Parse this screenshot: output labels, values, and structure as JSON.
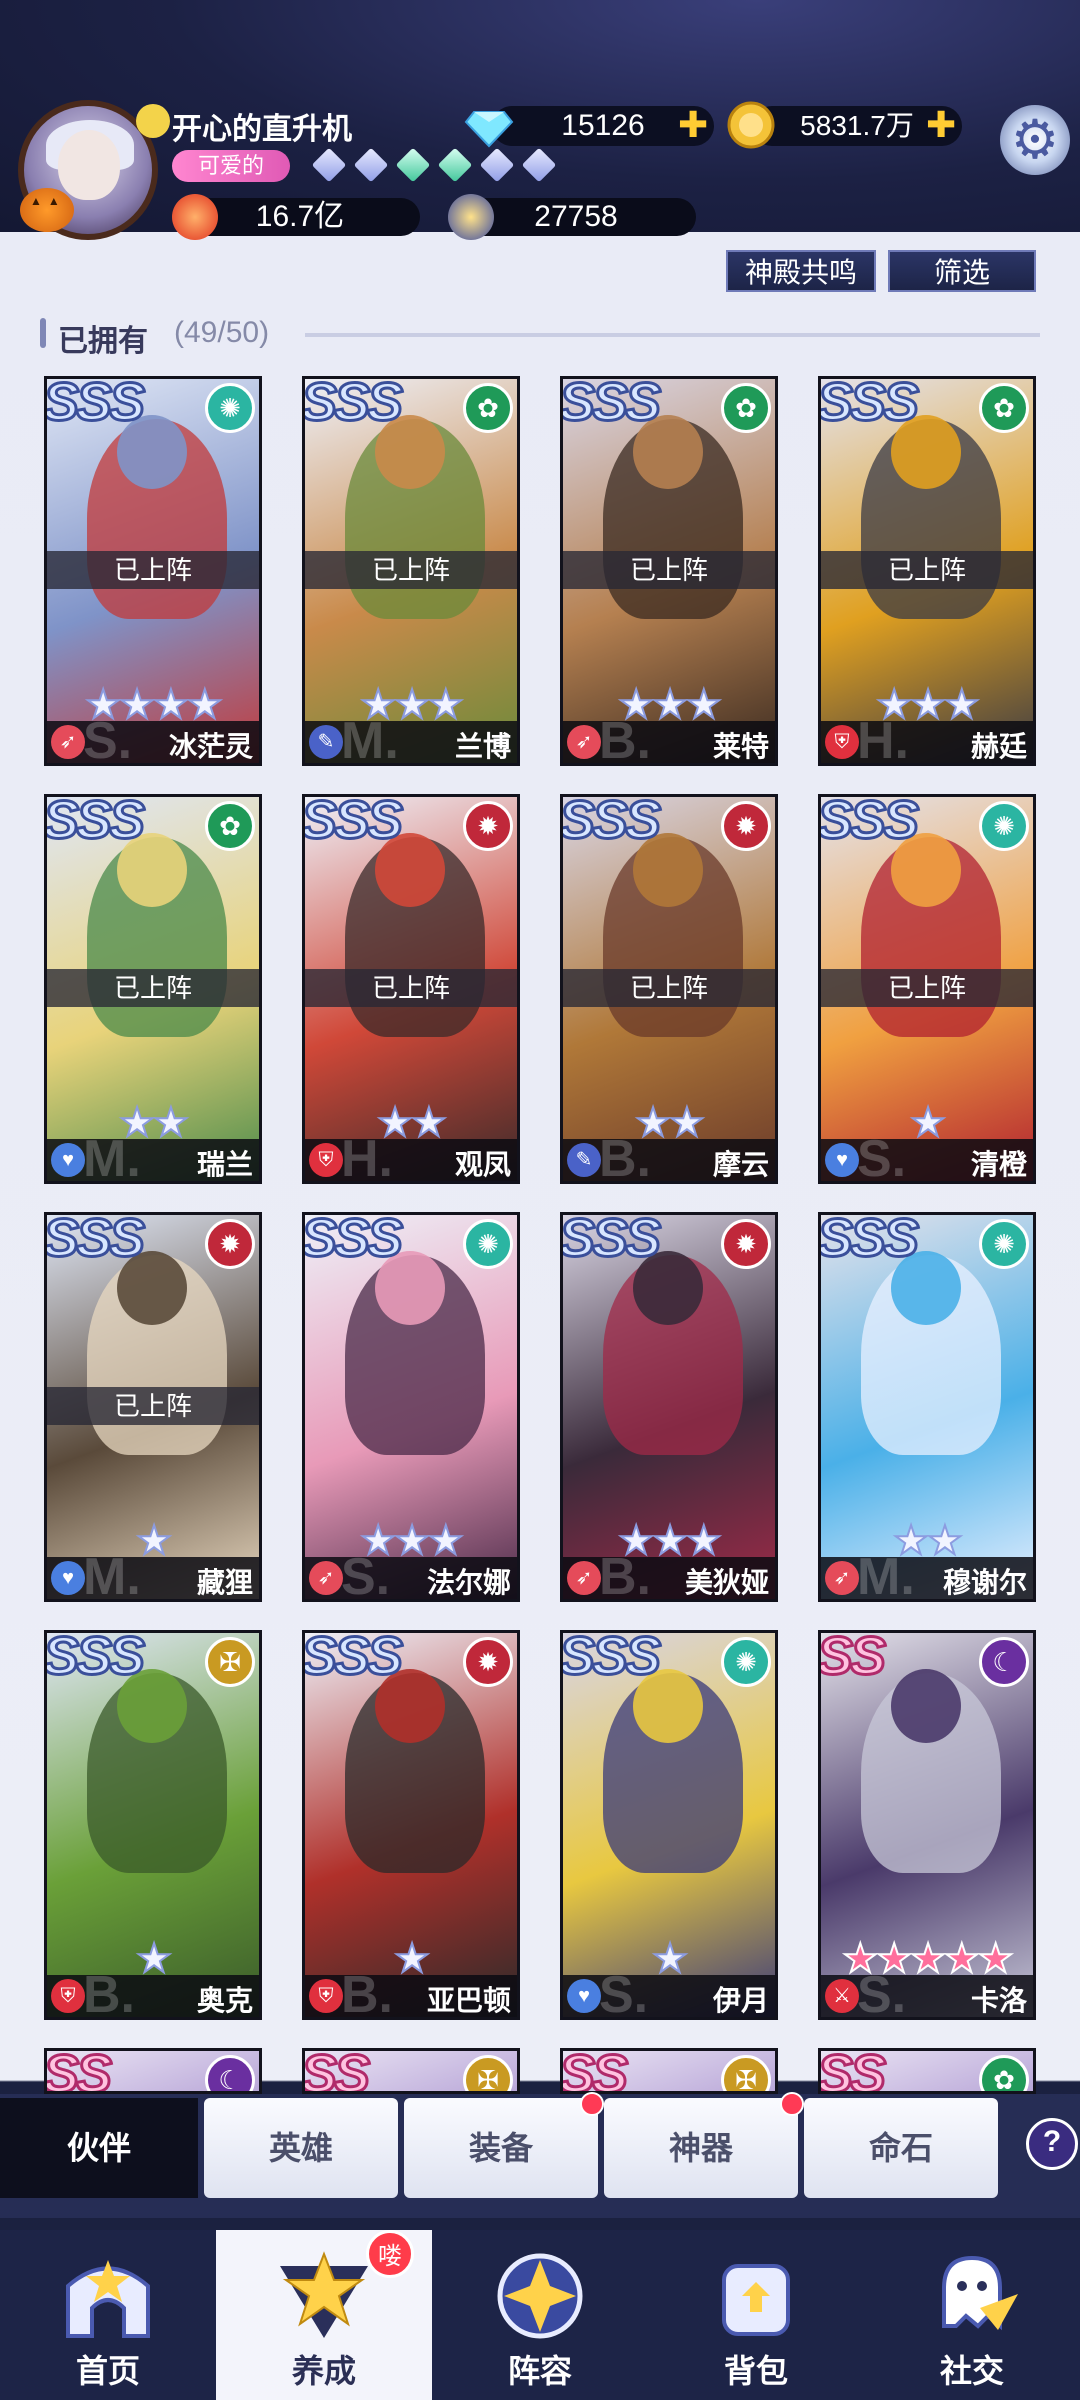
{
  "player": {
    "nickname": "开心的直升机",
    "title_badge": "可爱的",
    "power": "16.7亿",
    "arena_points": "27758"
  },
  "currencies": {
    "diamonds": "15126",
    "gold": "5831.7万"
  },
  "top_buttons": {
    "resonance": "神殿共鸣",
    "filter": "筛选"
  },
  "owned": {
    "label": "已拥有",
    "count": "(49/50)"
  },
  "deployed_label": "已上阵",
  "heroes": [
    {
      "name": "冰茫灵",
      "rank": "SSS",
      "element": "wind",
      "stars": 4,
      "deployed": true,
      "class": "archer",
      "tier": "S."
    },
    {
      "name": "兰博",
      "rank": "SSS",
      "element": "nature",
      "stars": 3,
      "deployed": true,
      "class": "mage",
      "tier": "M."
    },
    {
      "name": "莱特",
      "rank": "SSS",
      "element": "nature",
      "stars": 3,
      "deployed": true,
      "class": "archer",
      "tier": "B."
    },
    {
      "name": "赫廷",
      "rank": "SSS",
      "element": "nature",
      "stars": 3,
      "deployed": true,
      "class": "tank",
      "tier": "H."
    },
    {
      "name": "瑞兰",
      "rank": "SSS",
      "element": "nature",
      "stars": 2,
      "deployed": true,
      "class": "support",
      "tier": "M."
    },
    {
      "name": "观凤",
      "rank": "SSS",
      "element": "fire",
      "stars": 2,
      "deployed": true,
      "class": "tank",
      "tier": "H."
    },
    {
      "name": "摩云",
      "rank": "SSS",
      "element": "fire",
      "stars": 2,
      "deployed": true,
      "class": "mage",
      "tier": "B."
    },
    {
      "name": "清橙",
      "rank": "SSS",
      "element": "wind",
      "stars": 1,
      "deployed": true,
      "class": "support",
      "tier": "S."
    },
    {
      "name": "藏狸",
      "rank": "SSS",
      "element": "fire",
      "stars": 1,
      "deployed": true,
      "class": "support",
      "tier": "M."
    },
    {
      "name": "法尔娜",
      "rank": "SSS",
      "element": "wind",
      "stars": 3,
      "deployed": false,
      "class": "archer",
      "tier": "S."
    },
    {
      "name": "美狄娅",
      "rank": "SSS",
      "element": "fire",
      "stars": 3,
      "deployed": false,
      "class": "archer",
      "tier": "B."
    },
    {
      "name": "穆谢尔",
      "rank": "SSS",
      "element": "wind",
      "stars": 2,
      "deployed": false,
      "class": "archer",
      "tier": "M."
    },
    {
      "name": "奥克",
      "rank": "SSS",
      "element": "light",
      "stars": 1,
      "deployed": false,
      "class": "tank",
      "tier": "B."
    },
    {
      "name": "亚巴顿",
      "rank": "SSS",
      "element": "fire",
      "stars": 1,
      "deployed": false,
      "class": "tank",
      "tier": "B."
    },
    {
      "name": "伊月",
      "rank": "SSS",
      "element": "wind",
      "stars": 1,
      "deployed": false,
      "class": "support",
      "tier": "S."
    },
    {
      "name": "卡洛",
      "rank": "SS",
      "element": "dark",
      "stars": 5,
      "deployed": false,
      "class": "warrior",
      "tier": "S.",
      "star_color": "pink"
    }
  ],
  "partial_row": [
    {
      "rank": "SS",
      "element": "dark"
    },
    {
      "rank": "SS",
      "element": "light"
    },
    {
      "rank": "SS",
      "element": "light"
    },
    {
      "rank": "SS",
      "element": "nature"
    }
  ],
  "tabs": [
    {
      "label": "伙伴",
      "active": true,
      "dot": false
    },
    {
      "label": "英雄",
      "active": false,
      "dot": false
    },
    {
      "label": "装备",
      "active": false,
      "dot": true
    },
    {
      "label": "神器",
      "active": false,
      "dot": true
    },
    {
      "label": "命石",
      "active": false,
      "dot": false
    }
  ],
  "nav": [
    {
      "label": "首页",
      "active": false
    },
    {
      "label": "养成",
      "active": true,
      "badge": "喽"
    },
    {
      "label": "阵容",
      "active": false
    },
    {
      "label": "背包",
      "active": false
    },
    {
      "label": "社交",
      "active": false
    }
  ],
  "colors": {
    "element_wind": "#2bb5a2",
    "element_nature": "#1f9a58",
    "element_fire": "#c0283a",
    "element_light": "#c99a22",
    "element_dark": "#6a2fa0",
    "class_archer": "#e54b5a",
    "class_mage": "#4a62c8",
    "class_tank": "#e0303e",
    "class_support": "#4a7fe0",
    "class_warrior": "#e0303e"
  }
}
